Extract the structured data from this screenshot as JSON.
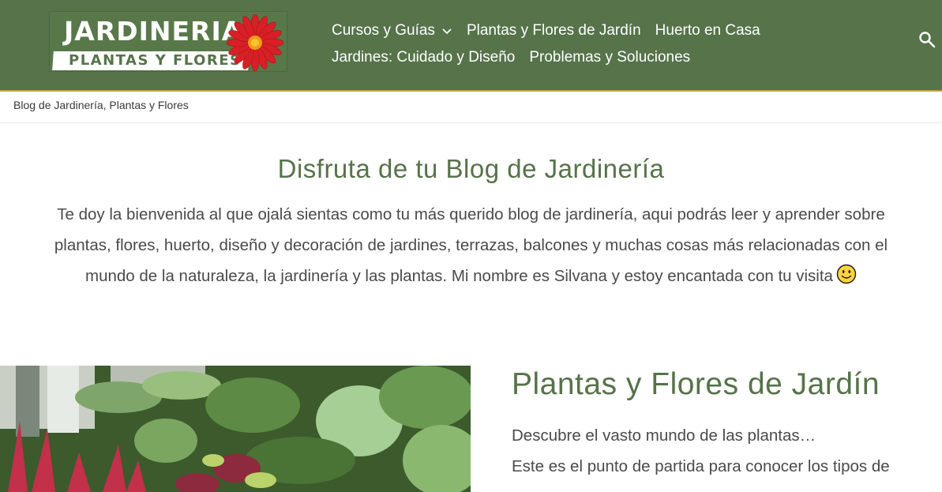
{
  "logo": {
    "line1": "JARDINERIA",
    "line2": "PLANTAS Y FLORES"
  },
  "nav": {
    "items": [
      {
        "label": "Cursos y Guías"
      },
      {
        "label": "Plantas y Flores de Jardín"
      },
      {
        "label": "Huerto en Casa"
      },
      {
        "label": "Jardines: Cuidado y Diseño"
      },
      {
        "label": "Problemas y Soluciones"
      }
    ],
    "search_icon": "search-icon"
  },
  "breadcrumb": "Blog de Jardinería, Plantas y Flores",
  "intro": {
    "title": "Disfruta de tu Blog de Jardinería",
    "text": "Te doy la bienvenida al que ojalá sientas como tu más querido blog de jardinería, aqui podrás leer y aprender sobre plantas, flores, huerto, diseño y decoración de jardines, terrazas, balcones y muchas cosas más relacionadas con el mundo de la naturaleza, la jardinería y las plantas. Mi nombre es Silvana y estoy encantada con tu visita"
  },
  "section": {
    "title": "Plantas y Flores de Jardín",
    "line1": "Descubre el vasto mundo de las plantas…",
    "line2": "Este es el punto de partida para conocer los tipos de"
  },
  "colors": {
    "header": "#56734a",
    "accent": "#c3a43d",
    "heading": "#56734a"
  }
}
